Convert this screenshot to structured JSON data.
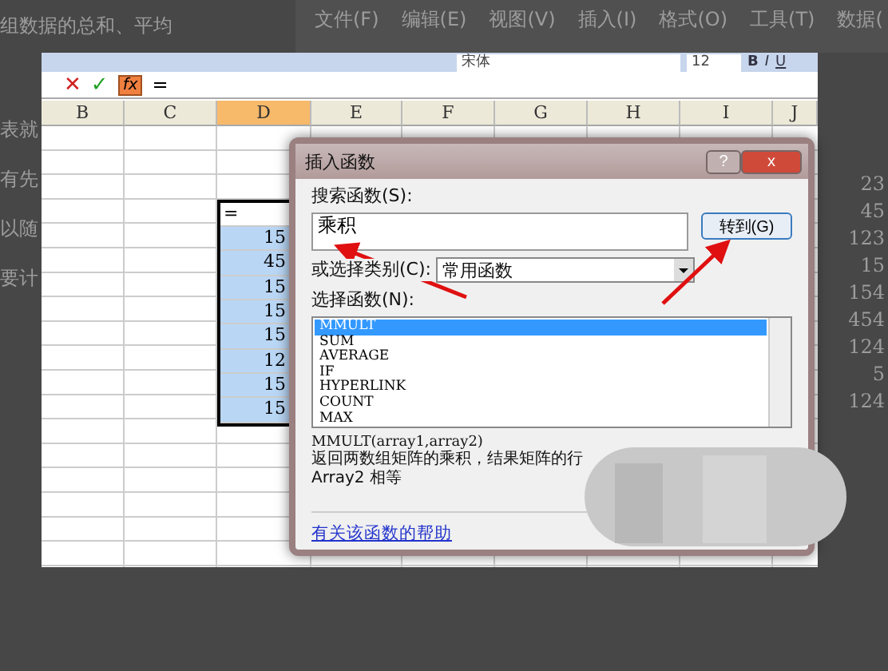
{
  "background": {
    "top_text": "组数据的总和、平均",
    "left_texts": [
      "表就",
      "有先",
      "以随",
      "要计"
    ],
    "menu": [
      "文件(F)",
      "编辑(E)",
      "视图(V)",
      "插入(I)",
      "格式(O)",
      "工具(T)",
      "数据("
    ],
    "right_numbers": [
      "23",
      "45",
      "123",
      "15",
      "154",
      "454",
      "124",
      "5",
      "124"
    ]
  },
  "toolbar": {
    "font": "宋体",
    "size": "12",
    "styles": [
      "B",
      "I",
      "U"
    ]
  },
  "formula_bar": {
    "cancel": "✕",
    "confirm": "✓",
    "fx": "fx",
    "value": "="
  },
  "sheet": {
    "columns": [
      {
        "label": "B",
        "selected": false
      },
      {
        "label": "C",
        "selected": false
      },
      {
        "label": "D",
        "selected": true
      },
      {
        "label": "E",
        "selected": false
      },
      {
        "label": "F",
        "selected": false
      },
      {
        "label": "G",
        "selected": false
      },
      {
        "label": "H",
        "selected": false
      },
      {
        "label": "I",
        "selected": false
      },
      {
        "label": "J",
        "selected": false
      }
    ],
    "d_cells": [
      {
        "value": "=",
        "selected": false
      },
      {
        "value": "15",
        "selected": true
      },
      {
        "value": "45",
        "selected": true
      },
      {
        "value": "15",
        "selected": true
      },
      {
        "value": "15",
        "selected": true
      },
      {
        "value": "15",
        "selected": true
      },
      {
        "value": "12",
        "selected": true
      },
      {
        "value": "15",
        "selected": true
      },
      {
        "value": "15",
        "selected": true
      }
    ]
  },
  "dialog": {
    "title": "插入函数",
    "help": "?",
    "close": "x",
    "search_label": "搜索函数(S):",
    "search_value": "乘积",
    "go_button": "转到(G)",
    "category_label": "或选择类别(C):",
    "category_value": "常用函数",
    "function_label": "选择函数(N):",
    "functions": [
      {
        "name": "MMULT",
        "selected": true
      },
      {
        "name": "SUM",
        "selected": false
      },
      {
        "name": "AVERAGE",
        "selected": false
      },
      {
        "name": "IF",
        "selected": false
      },
      {
        "name": "HYPERLINK",
        "selected": false
      },
      {
        "name": "COUNT",
        "selected": false
      },
      {
        "name": "MAX",
        "selected": false
      }
    ],
    "signature": "MMULT(array1,array2)",
    "description": "返回两数组矩阵的乘积，结果矩阵的行",
    "description_2": "Array2 相等",
    "help_link": "有关该函数的帮助"
  }
}
